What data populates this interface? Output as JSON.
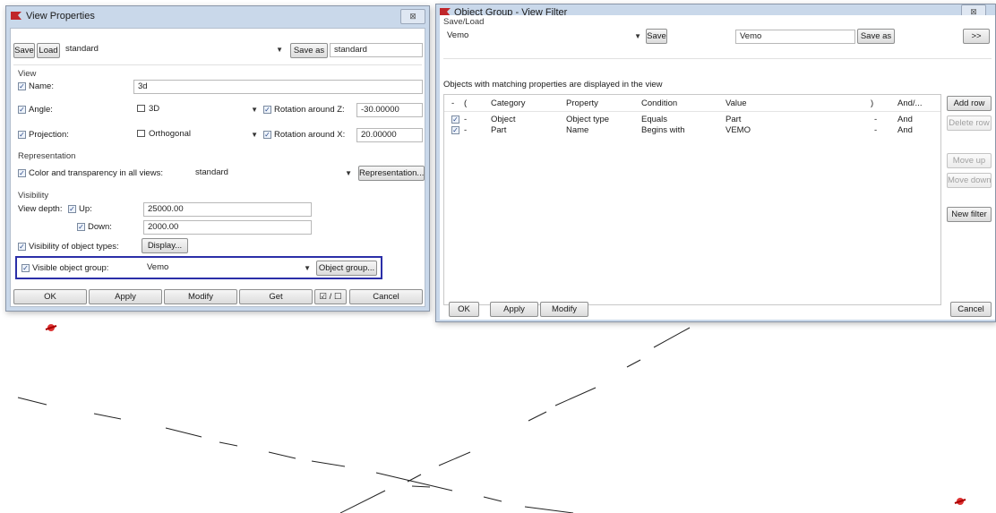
{
  "view_properties": {
    "title": "View Properties",
    "close": "⊠",
    "save_label": "Save",
    "load_label": "Load",
    "preset_value": "standard",
    "save_as_label": "Save as",
    "save_as_value": "standard",
    "group_view": "View",
    "name_label": "Name:",
    "name_value": "3d",
    "angle_label": "Angle:",
    "angle_value": "3D",
    "rotation_z_label": "Rotation around Z:",
    "rotation_z_value": "-30.00000",
    "projection_label": "Projection:",
    "projection_value": "Orthogonal",
    "rotation_x_label": "Rotation around X:",
    "rotation_x_value": "20.00000",
    "group_representation": "Representation",
    "color_label": "Color and transparency in all views:",
    "color_value": "standard",
    "representation_button": "Representation...",
    "group_visibility": "Visibility",
    "view_depth_label": "View depth:",
    "up_label": "Up:",
    "up_value": "25000.00",
    "down_label": "Down:",
    "down_value": "2000.00",
    "vis_types_label": "Visibility of object types:",
    "display_button": "Display...",
    "vis_group_label": "Visible object group:",
    "vis_group_value": "Vemo",
    "object_group_button": "Object group...",
    "ok": "OK",
    "apply": "Apply",
    "modify": "Modify",
    "get": "Get",
    "toggle": "☑ / ☐",
    "cancel": "Cancel"
  },
  "object_group": {
    "title": "Object Group - View Filter",
    "close": "⊠",
    "save_load_label": "Save/Load",
    "preset_value": "Vemo",
    "save_label": "Save",
    "save_as_value": "Vemo",
    "save_as_label": "Save as",
    "more_label": ">>",
    "info_text": "Objects with matching properties are displayed in the view",
    "columns": {
      "dash": "-",
      "paren_open": "(",
      "category": "Category",
      "property": "Property",
      "condition": "Condition",
      "value": "Value",
      "paren_close": ")",
      "and_or": "And/..."
    },
    "rows": [
      {
        "dash": "-",
        "category": "Object",
        "property": "Object type",
        "condition": "Equals",
        "value": "Part",
        "paren_close": "-",
        "and_or": "And"
      },
      {
        "dash": "-",
        "category": "Part",
        "property": "Name",
        "condition": "Begins with",
        "value": "VEMO",
        "paren_close": "-",
        "and_or": "And"
      }
    ],
    "add_row": "Add row",
    "delete_row": "Delete row",
    "move_up": "Move up",
    "move_down": "Move down",
    "new_filter": "New filter",
    "ok": "OK",
    "apply": "Apply",
    "modify": "Modify",
    "cancel": "Cancel"
  },
  "colors": {
    "highlight": "#2b2fa8",
    "window_frame": "#c9d8ea",
    "app_icon": "#c0262a"
  }
}
